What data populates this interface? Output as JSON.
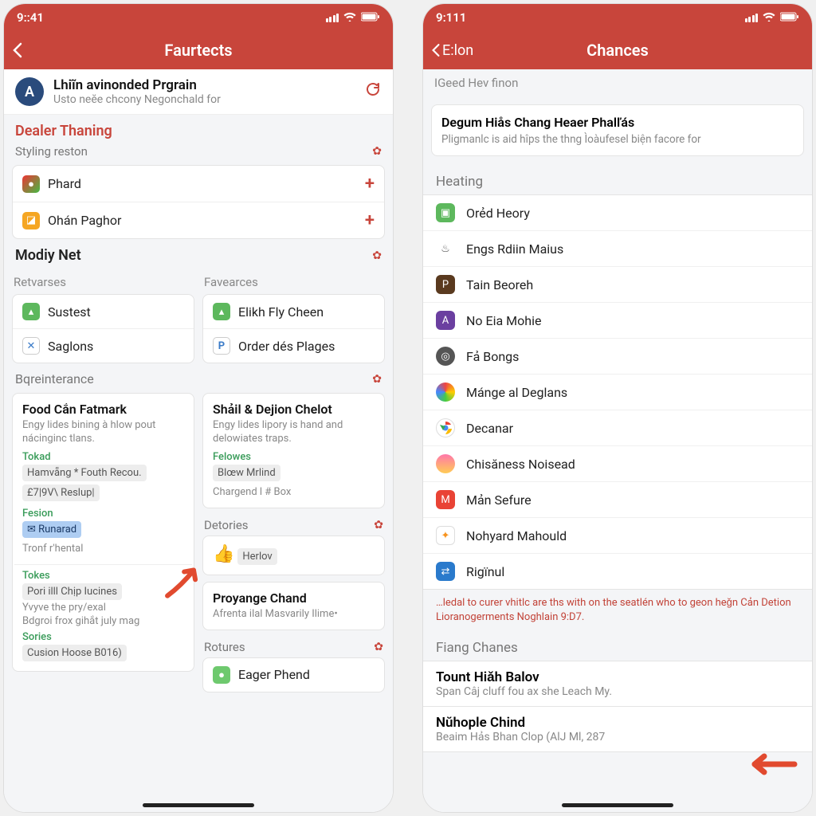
{
  "left": {
    "status_time": "9::41",
    "nav_title": "Faurtects",
    "profile": {
      "avatar": "A",
      "title": "Lhiĩn avinonded Prgrain",
      "sub": "Usto neĕe chcony Negonchald for"
    },
    "dealer": {
      "heading": "Dealer Thaning",
      "sub": "Styling reston",
      "items": [
        {
          "label": "Phard"
        },
        {
          "label": "Ohán Paghor"
        }
      ]
    },
    "modiy": {
      "heading": "Modiy Net"
    },
    "retvarses": {
      "heading": "Retvarses",
      "items": [
        {
          "label": "Sustest"
        },
        {
          "label": "Saglons"
        }
      ]
    },
    "favearces": {
      "heading": "Favearces",
      "items": [
        {
          "label": "Elikh Fly Cheen"
        },
        {
          "label": "Order dés Plages"
        }
      ]
    },
    "bq": {
      "heading": "Bqreinterance",
      "cards": [
        {
          "title": "Food Cắn Fatmark",
          "desc": "Engy lides bining à hlow pout nácinginc tlans.",
          "tag": "Tokad",
          "chip1": "Hamvẵng * Fouth Recou.",
          "chip2": "£7|9V\\ Reslup|",
          "tag2": "Fesion",
          "chip3": "Runarad",
          "line": "Tronf r'hental",
          "tag3": "Tokes",
          "chip4": "Pori illl Chịp Iucines",
          "line2": "Yvyve the pry/exal",
          "line3": "Bdgroi frox gihắt july mag",
          "tag4": "Sories",
          "chip5": "Cusion Hoose B016)"
        },
        {
          "title": "Shảil & Dejion Chelot",
          "desc": "Engy lides lipory is hand and delowiates traps.",
          "tag": "Felowes",
          "chip1": "Blœw Mrlind",
          "line": "Chargend l # Box"
        }
      ]
    },
    "detories": {
      "heading": "Detories",
      "chip": "Herlov",
      "card_title": "Proyange Chand",
      "card_desc": "Afrenta ilal Masvarily Ilime•"
    },
    "rotures": {
      "heading": "Rotures",
      "item": "Eager Phend"
    }
  },
  "right": {
    "status_time": "9:111",
    "nav_back": "E:lon",
    "nav_title": "Chances",
    "breadcrumb": "IGeed Hev finon",
    "desc": {
      "title": "Degum Hiås Chang Heaer Phalľás",
      "text": "Pligmanlc is aid hîps the thng Ìoàufesel biện facore for"
    },
    "heating": {
      "heading": "Heating",
      "items": [
        {
          "label": "Orẻd Heory"
        },
        {
          "label": "Engs Rdiin Maius"
        },
        {
          "label": "Tain Beoreh"
        },
        {
          "label": "No Eia Mohie"
        },
        {
          "label": "Fả Bongs"
        },
        {
          "label": "Mánge al Deglans"
        },
        {
          "label": "Decanar"
        },
        {
          "label": "Chisăness Noisead"
        },
        {
          "label": "Mản Sefure"
        },
        {
          "label": "Nohyard Mahould"
        },
        {
          "label": "Rigïnul"
        }
      ],
      "note": "…ledal to curer vhitlc are ths with on the seatlén who to geon heǧn Cản Detion Lioranogerments Noghlain 9:D7."
    },
    "fiang": {
      "heading": "Fiang Chanes",
      "items": [
        {
          "title": "Tount Hiǎh Balov",
          "sub": "Span Câj cluff fou ax she Leach My."
        },
        {
          "title": "Nŭhople Chind",
          "sub": "Beaim Hảs Bhan Clop (AlJ Ml, 287"
        }
      ]
    }
  }
}
